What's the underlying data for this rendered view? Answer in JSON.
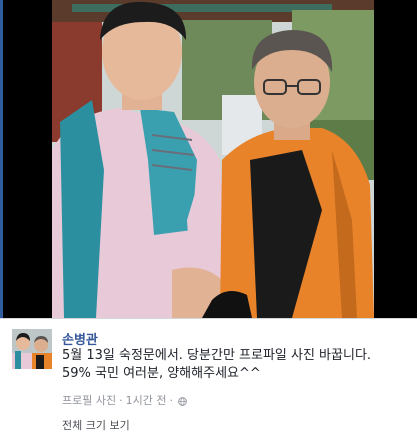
{
  "post": {
    "author": "손병관",
    "text_line1": "5월 13일 숙정문에서. 당분간만 프로파일 사진 바꿉니다.",
    "text_line2": "59% 국민 여러분, 양해해주세요^^",
    "meta_type": "프로필 사진",
    "meta_sep": "·",
    "meta_time": "1시간 전",
    "meta_sep2": "·",
    "privacy_icon": "globe-icon",
    "fullsize_label": "전체 크기 보기"
  },
  "colors": {
    "author_link": "#365899",
    "body_text": "#1d2129",
    "meta_text": "#90949c",
    "photo_backdrop": "#000000"
  }
}
